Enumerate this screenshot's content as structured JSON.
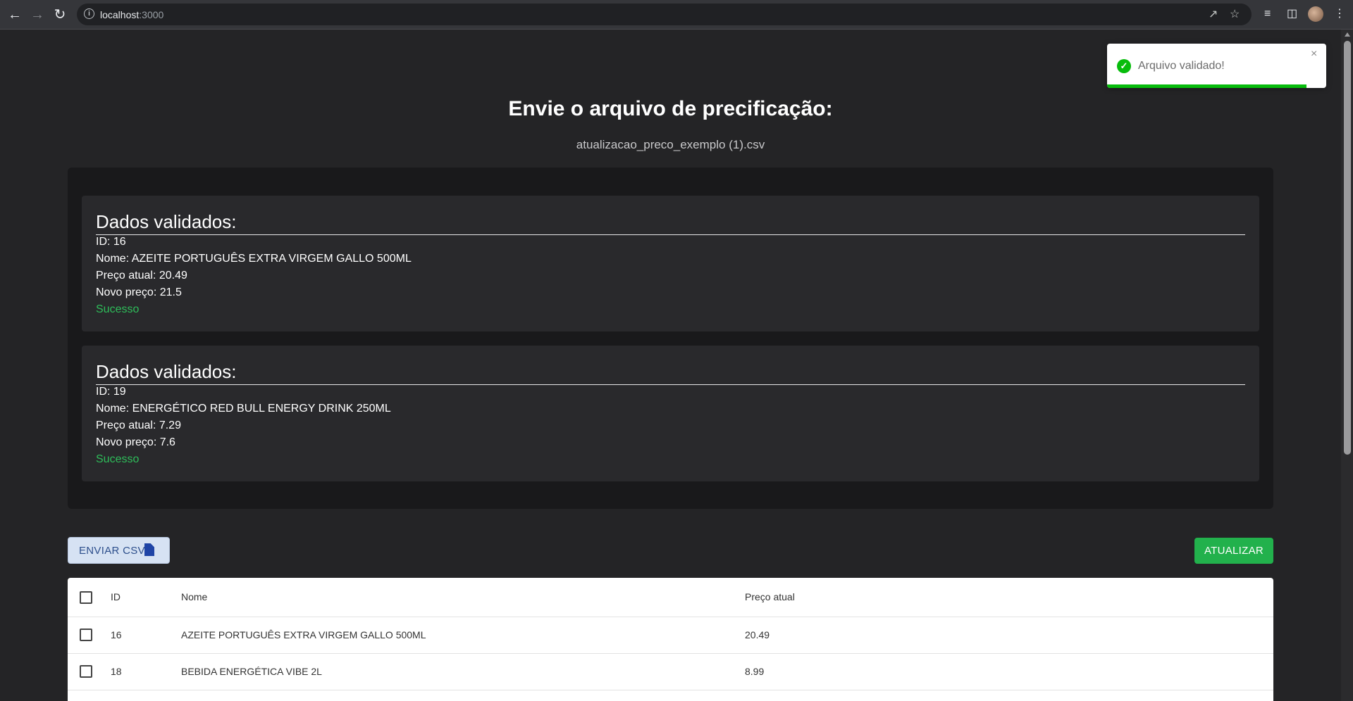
{
  "browser": {
    "url_host": "localhost",
    "url_port": ":3000"
  },
  "page": {
    "title": "Envie o arquivo de precificação:",
    "file_name": "atualizacao_preco_exemplo (1).csv"
  },
  "validated": [
    {
      "heading": "Dados validados:",
      "id_line": "ID: 16",
      "name_line": "Nome: AZEITE PORTUGUÊS EXTRA VIRGEM GALLO 500ML",
      "current_price_line": "Preço atual: 20.49",
      "new_price_line": "Novo preço: 21.5",
      "status": "Sucesso"
    },
    {
      "heading": "Dados validados:",
      "id_line": "ID: 19",
      "name_line": "Nome: ENERGÉTICO RED BULL ENERGY DRINK 250ML",
      "current_price_line": "Preço atual: 7.29",
      "new_price_line": "Novo preço: 7.6",
      "status": "Sucesso"
    }
  ],
  "actions": {
    "send_csv_label": "ENVIAR CSV",
    "update_label": "ATUALIZAR"
  },
  "table": {
    "columns": [
      "ID",
      "Nome",
      "Preço atual"
    ],
    "rows": [
      {
        "id": "16",
        "name": "AZEITE PORTUGUÊS EXTRA VIRGEM GALLO 500ML",
        "price": "20.49"
      },
      {
        "id": "18",
        "name": "BEBIDA ENERGÉTICA VIBE 2L",
        "price": "8.99"
      }
    ]
  },
  "toast": {
    "message": "Arquivo validado!",
    "close_glyph": "×",
    "progress_fraction": 0.91,
    "accent": "#07bc0c"
  },
  "colors": {
    "success_text": "#2ebd5a",
    "update_button": "#22b14c",
    "send_button": "#d6e2f3"
  }
}
